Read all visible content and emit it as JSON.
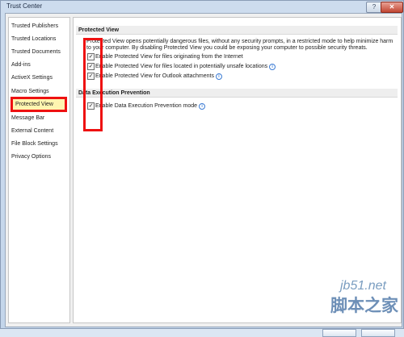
{
  "window": {
    "title": "Trust Center"
  },
  "titlebar": {
    "help_label": "?",
    "close_label": "✕"
  },
  "nav": {
    "items": [
      {
        "label": "Trusted Publishers"
      },
      {
        "label": "Trusted Locations"
      },
      {
        "label": "Trusted Documents"
      },
      {
        "label": "Add-ins"
      },
      {
        "label": "ActiveX Settings"
      },
      {
        "label": "Macro Settings"
      },
      {
        "label": "Protected View",
        "selected": true
      },
      {
        "label": "Message Bar"
      },
      {
        "label": "External Content"
      },
      {
        "label": "File Block Settings"
      },
      {
        "label": "Privacy Options"
      }
    ]
  },
  "protected_view": {
    "header": "Protected View",
    "description_line1": "Protected View opens potentially dangerous files, without any security prompts, in a restricted mode to help minimize harm",
    "description_line2": "to your computer. By disabling Protected View you could be exposing your computer to possible security threats.",
    "options": [
      {
        "label": "Enable Protected View for files originating from the Internet",
        "checked": true,
        "info": false
      },
      {
        "label": "Enable Protected View for files located in potentially unsafe locations",
        "checked": true,
        "info": true
      },
      {
        "label": "Enable Protected View for Outlook attachments",
        "checked": true,
        "info": true
      }
    ]
  },
  "dep": {
    "header": "Data Execution Prevention",
    "options": [
      {
        "label": "Enable Data Execution Prevention mode",
        "checked": true,
        "info": true
      }
    ]
  },
  "icons": {
    "checkbox_checked": "✓",
    "info_icon": "i"
  },
  "watermark": {
    "line1": "jb51.net",
    "line2": "脚本之家"
  },
  "colors": {
    "highlight_red": "#ee1111",
    "selected_bg": "#fff5b0",
    "info_blue": "#3b7bd4"
  }
}
